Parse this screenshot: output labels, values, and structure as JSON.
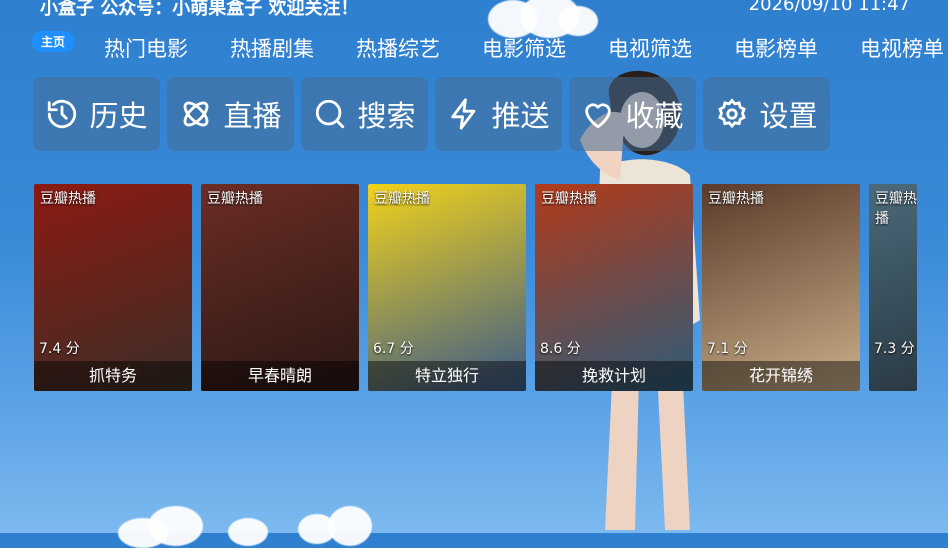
{
  "ticker": {
    "message": "小盒子  公众号：小萌果盒子  欢迎关注！",
    "clock": "2026/09/10 11:47"
  },
  "nav": {
    "home_badge": "主页",
    "tabs": [
      "热门电影",
      "热播剧集",
      "热播综艺",
      "电影筛选",
      "电视筛选",
      "电影榜单",
      "电视榜单"
    ]
  },
  "functions": [
    {
      "label": "历史",
      "icon": "history-icon"
    },
    {
      "label": "直播",
      "icon": "live-icon"
    },
    {
      "label": "搜索",
      "icon": "search-icon"
    },
    {
      "label": "推送",
      "icon": "push-icon"
    },
    {
      "label": "收藏",
      "icon": "heart-icon"
    },
    {
      "label": "设置",
      "icon": "gear-icon"
    }
  ],
  "cards": [
    {
      "tag": "豆瓣热播",
      "score": "7.4 分",
      "title": "抓特务",
      "colors": [
        "#8c1a12",
        "#3a2f28"
      ]
    },
    {
      "tag": "豆瓣热播",
      "score": "",
      "title": "早春晴朗",
      "colors": [
        "#6b2d25",
        "#2a1814"
      ]
    },
    {
      "tag": "豆瓣热播",
      "score": "6.7 分",
      "title": "特立独行",
      "colors": [
        "#f2d21a",
        "#3a5a8a"
      ]
    },
    {
      "tag": "豆瓣热播",
      "score": "8.6 分",
      "title": "挽救计划",
      "colors": [
        "#b23a1a",
        "#2d5d7a"
      ]
    },
    {
      "tag": "豆瓣热播",
      "score": "7.1 分",
      "title": "花开锦绣",
      "colors": [
        "#5a3a2a",
        "#c9b08a"
      ]
    },
    {
      "tag": "豆瓣热播",
      "score": "7.3 分",
      "title": "",
      "colors": [
        "#4b6a7a",
        "#2a3a45"
      ]
    }
  ]
}
